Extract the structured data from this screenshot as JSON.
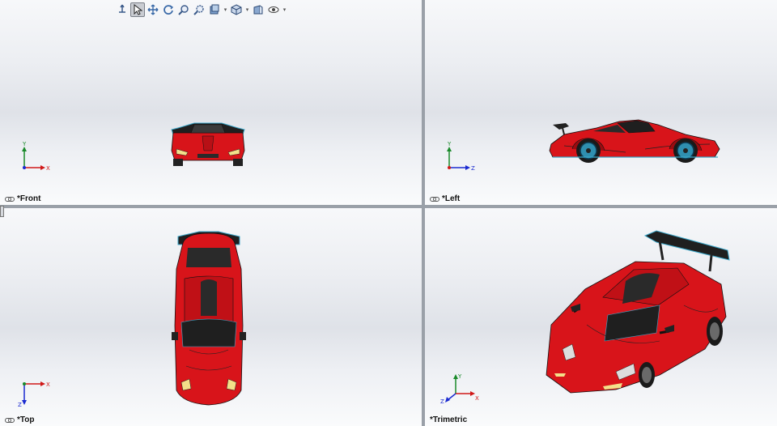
{
  "toolbar": {
    "items": [
      {
        "icon": "view-orientation-icon"
      },
      {
        "icon": "select-arrow-icon",
        "active": true
      },
      {
        "icon": "pan-icon"
      },
      {
        "icon": "rotate-icon"
      },
      {
        "icon": "zoom-to-fit-icon"
      },
      {
        "icon": "zoom-to-area-icon"
      },
      {
        "icon": "display-style-icon",
        "dropdown": true
      },
      {
        "icon": "view-cube-icon",
        "dropdown": true
      },
      {
        "icon": "section-view-icon"
      },
      {
        "icon": "hide-show-icon",
        "dropdown": true
      }
    ]
  },
  "viewports": {
    "front": {
      "label": "*Front",
      "axes": [
        "Y",
        "X"
      ]
    },
    "left": {
      "label": "*Left",
      "axes": [
        "Y",
        "Z"
      ]
    },
    "top": {
      "label": "*Top",
      "axes": [
        "X",
        "Z"
      ]
    },
    "trimetric": {
      "label": "*Trimetric",
      "axes": [
        "Y",
        "X",
        "Z"
      ]
    }
  },
  "colors": {
    "car_body": "#d8141a",
    "car_dark": "#2b2b2b",
    "axis_x": "#d01818",
    "axis_y": "#1a8a2a",
    "axis_z": "#1a2ad0",
    "background_top": "#f7f8fa",
    "splitter": "#9aa0a8"
  }
}
